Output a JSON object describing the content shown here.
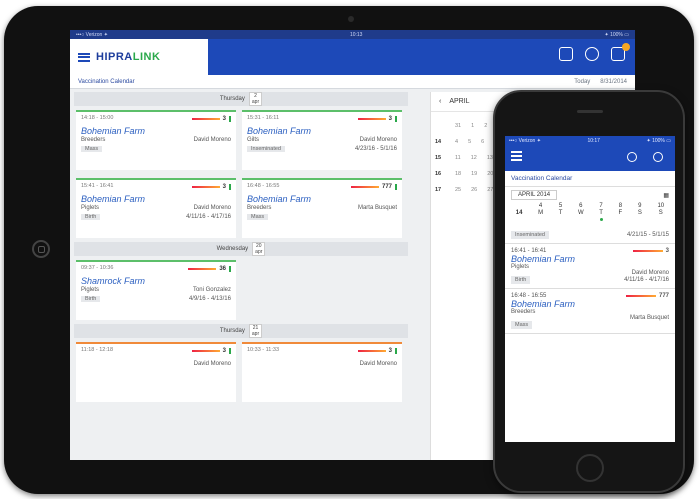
{
  "tablet": {
    "status": {
      "left": "•••○ Verizon ✦",
      "time": "10:13",
      "right": "✦ 100% ▭"
    },
    "brand": {
      "name_a": "HIPRA",
      "name_b": "LINK"
    },
    "subheader": {
      "title": "Vaccination Calendar",
      "today": "Today",
      "date": "8/31/2014"
    },
    "days": [
      {
        "label": "Thursday",
        "date": "2",
        "month": "apr",
        "cards": [
          {
            "time": "14:18 - 15:00",
            "count": "3",
            "farm": "Bohemian Farm",
            "kind": "Breeders",
            "person": "David Moreno",
            "tag": "Mass",
            "range": "",
            "accent": "green"
          },
          {
            "time": "15:31 - 16:11",
            "count": "3",
            "farm": "Bohemian Farm",
            "kind": "Gilts",
            "person": "David Moreno",
            "tag": "Inseminated",
            "range": "4/23/16 - 5/1/16",
            "accent": "green"
          },
          {
            "time": "15:41 - 16:41",
            "count": "3",
            "farm": "Bohemian Farm",
            "kind": "Piglets",
            "person": "David Moreno",
            "tag": "Birth",
            "range": "4/11/16 - 4/17/16",
            "accent": "green"
          },
          {
            "time": "16:48 - 16:55",
            "count": "777",
            "farm": "Bohemian Farm",
            "kind": "Breeders",
            "person": "Marta Busquet",
            "tag": "Mass",
            "range": "",
            "accent": "green"
          }
        ]
      },
      {
        "label": "Wednesday",
        "date": "20",
        "month": "apr",
        "cards": [
          {
            "time": "09:37 - 10:36",
            "count": "36",
            "farm": "Shamrock Farm",
            "kind": "Piglets",
            "person": "Toni Gonzalez",
            "tag": "Birth",
            "range": "4/9/16 - 4/13/16",
            "accent": "green"
          }
        ]
      },
      {
        "label": "Thursday",
        "date": "21",
        "month": "apr",
        "cards": [
          {
            "time": "11:18 - 12:18",
            "count": "3",
            "farm": "",
            "kind": "",
            "person": "David Moreno",
            "tag": "",
            "range": "",
            "accent": "orange"
          },
          {
            "time": "10:33 - 11:33",
            "count": "3",
            "farm": "",
            "kind": "",
            "person": "David Moreno",
            "tag": "",
            "range": "",
            "accent": "orange"
          }
        ]
      }
    ],
    "side": {
      "month": "APRIL",
      "weeks": [
        [
          "",
          "31",
          "1",
          "2",
          "3"
        ],
        [
          "14",
          "4",
          "5",
          "6",
          "7"
        ],
        [
          "15",
          "11",
          "12",
          "13",
          "14"
        ],
        [
          "16",
          "18",
          "19",
          "20",
          "21"
        ],
        [
          "17",
          "25",
          "26",
          "27",
          "28"
        ]
      ]
    }
  },
  "phone": {
    "status": {
      "left": "•••○ Verizon ✦",
      "time": "10:17",
      "right": "✦ 100% ▭"
    },
    "title": "Vaccination Calendar",
    "month": "APRIL 2014",
    "week": [
      {
        "num": "4",
        "day": "M"
      },
      {
        "num": "5",
        "day": "T"
      },
      {
        "num": "6",
        "day": "W"
      },
      {
        "num": "7",
        "day": "T",
        "dot": true
      },
      {
        "num": "8",
        "day": "F"
      },
      {
        "num": "9",
        "day": "S"
      },
      {
        "num": "10",
        "day": "S"
      }
    ],
    "week_label": "14",
    "first": {
      "tag": "Inseminated",
      "range": "4/21/15 - 5/1/15"
    },
    "items": [
      {
        "time": "16:41 - 16:41",
        "count": "3",
        "farm": "Bohemian Farm",
        "kind": "Piglets",
        "person": "David Moreno",
        "tag": "Birth",
        "range": "4/11/16 - 4/17/16"
      },
      {
        "time": "16:48 - 16:55",
        "count": "777",
        "farm": "Bohemian Farm",
        "kind": "Breeders",
        "person": "Marta Busquet",
        "tag": "Mass",
        "range": ""
      }
    ]
  }
}
